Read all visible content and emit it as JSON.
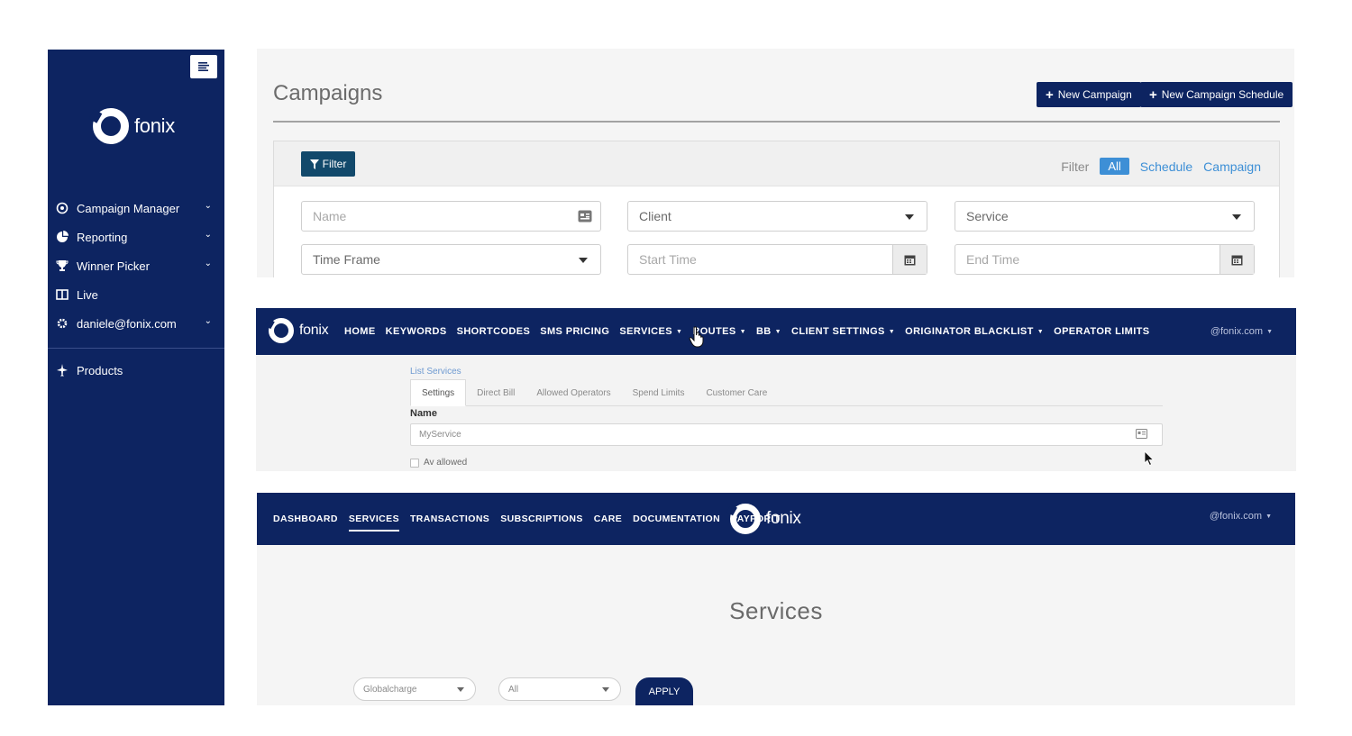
{
  "sidebar": {
    "brand": "fonix",
    "items": [
      {
        "label": "Campaign Manager",
        "icon": "target-icon",
        "has_dropdown": true
      },
      {
        "label": "Reporting",
        "icon": "pie-chart-icon",
        "has_dropdown": true
      },
      {
        "label": "Winner Picker",
        "icon": "trophy-icon",
        "has_dropdown": true
      },
      {
        "label": "Live",
        "icon": "columns-icon",
        "has_dropdown": false
      },
      {
        "label": "daniele@fonix.com",
        "icon": "gear-icon",
        "has_dropdown": true
      }
    ],
    "products_label": "Products"
  },
  "campaigns": {
    "title": "Campaigns",
    "new_campaign_label": "New Campaign",
    "new_schedule_label": "New Campaign Schedule",
    "filter_button": "Filter",
    "filter_label": "Filter",
    "filter_tabs": [
      "All",
      "Schedule",
      "Campaign"
    ],
    "fields": {
      "name_placeholder": "Name",
      "client": "Client",
      "service": "Service",
      "time_frame": "Time Frame",
      "start_placeholder": "Start Time",
      "end_placeholder": "End Time"
    }
  },
  "admin_nav": {
    "brand": "fonix",
    "links": [
      "HOME",
      "KEYWORDS",
      "SHORTCODES",
      "SMS PRICING",
      "SERVICES",
      "ROUTES",
      "BB",
      "CLIENT SETTINGS",
      "ORIGINATOR BLACKLIST",
      "OPERATOR LIMITS"
    ],
    "account": "@fonix.com"
  },
  "service_edit": {
    "breadcrumb": "List Services",
    "tabs": [
      "Settings",
      "Direct Bill",
      "Allowed Operators",
      "Spend Limits",
      "Customer Care"
    ],
    "name_label": "Name",
    "name_value": "MyService",
    "checkbox_label": "Av allowed"
  },
  "portal_nav": {
    "links": [
      "DASHBOARD",
      "SERVICES",
      "TRANSACTIONS",
      "SUBSCRIPTIONS",
      "CARE",
      "DOCUMENTATION",
      "PAYFORIT"
    ],
    "active": "SERVICES",
    "brand": "fonix",
    "account": "@fonix.com"
  },
  "services_list": {
    "title": "Services",
    "client_select": "Globalcharge",
    "status_select": "All",
    "apply_label": "APPLY"
  },
  "colors": {
    "navy": "#0d2461",
    "filter_teal": "#12496b",
    "link_blue": "#3d8fd6"
  }
}
